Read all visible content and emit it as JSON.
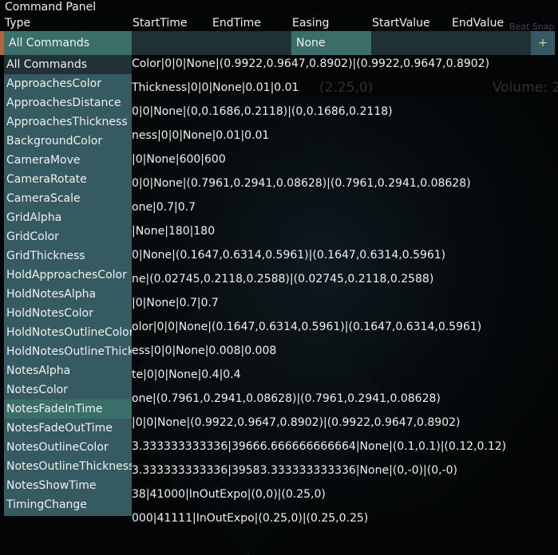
{
  "panel": {
    "title": "Command Panel",
    "columns": [
      "Type",
      "StartTime",
      "EndTime",
      "Easing",
      "StartValue",
      "EndValue"
    ]
  },
  "filters": {
    "type_selected": "All Commands",
    "easing_selected": "None",
    "add_label": "+"
  },
  "background": {
    "snap_text": "Beat Snap Divisor",
    "coord_text": "(2.25,0)",
    "volume_text": "Volume: 2"
  },
  "rows": [
    "Color|0|0|None|(0.9922,0.9647,0.8902)|(0.9922,0.9647,0.8902)",
    "Thickness|0|0|None|0.01|0.01",
    "0|0|None|(0,0.1686,0.2118)|(0,0.1686,0.2118)",
    "ness|0|0|None|0.01|0.01",
    "|0|None|600|600",
    "0|0|None|(0.7961,0.2941,0.08628)|(0.7961,0.2941,0.08628)",
    "one|0.7|0.7",
    "|None|180|180",
    "0|None|(0.1647,0.6314,0.5961)|(0.1647,0.6314,0.5961)",
    "ne|(0.02745,0.2118,0.2588)|(0.02745,0.2118,0.2588)",
    "|0|None|0.7|0.7",
    "olor|0|0|None|(0.1647,0.6314,0.5961)|(0.1647,0.6314,0.5961)",
    "ess|0|0|None|0.008|0.008",
    "te|0|0|None|0.4|0.4",
    "one|(0.7961,0.2941,0.08628)|(0.7961,0.2941,0.08628)",
    "|0|0|None|(0.9922,0.9647,0.8902)|(0.9922,0.9647,0.8902)",
    "3.333333333336|39666.666666666664|None|(0.1,0.1)|(0.12,0.12)",
    "3.333333333336|39583.333333333336|None|(0,-0)|(0,-0)",
    "38|41000|InOutExpo|(0,0)|(0.25,0)",
    "000|41111|InOutExpo|(0.25,0)|(0.25,0.25)"
  ],
  "dropdown": {
    "items": [
      "All Commands",
      "ApproachesColor",
      "ApproachesDistance",
      "ApproachesThickness",
      "BackgroundColor",
      "CameraMove",
      "CameraRotate",
      "CameraScale",
      "GridAlpha",
      "GridColor",
      "GridThickness",
      "HoldApproachesColor",
      "HoldNotesAlpha",
      "HoldNotesColor",
      "HoldNotesOutlineColor",
      "HoldNotesOutlineThickness",
      "NotesAlpha",
      "NotesColor",
      "NotesFadeInTime",
      "NotesFadeOutTime",
      "NotesOutlineColor",
      "NotesOutlineThickness",
      "NotesShowTime",
      "TimingChange"
    ],
    "current_index": 0,
    "hover_index": 18
  }
}
